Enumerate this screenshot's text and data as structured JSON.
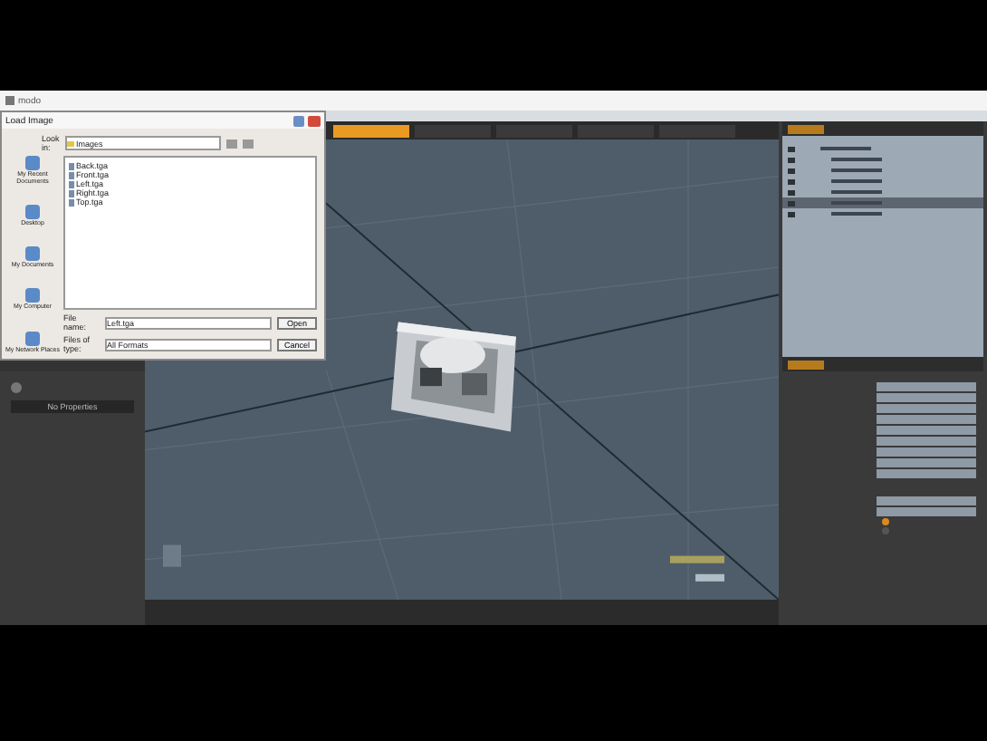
{
  "app": {
    "title": "modo"
  },
  "dialog": {
    "title": "Load Image",
    "look_in_label": "Look in:",
    "look_in": "Images",
    "places": [
      {
        "label": "My Recent Documents"
      },
      {
        "label": "Desktop"
      },
      {
        "label": "My Documents"
      },
      {
        "label": "My Computer"
      },
      {
        "label": "My Network Places"
      }
    ],
    "files": [
      "Back.tga",
      "Front.tga",
      "Left.tga",
      "Right.tga",
      "Top.tga"
    ],
    "file_name_label": "File name:",
    "file_name": "Left.tga",
    "file_type_label": "Files of type:",
    "file_type": "All Formats",
    "buttons": [
      "Open",
      "Cancel"
    ]
  },
  "left_panel": {
    "button": "No Properties"
  },
  "viewport_tabs": [
    {
      "selected": true
    },
    {
      "selected": false
    },
    {
      "selected": false
    },
    {
      "selected": false
    },
    {
      "selected": false
    }
  ],
  "tree_rows": [
    {
      "selected": false
    },
    {
      "selected": false
    },
    {
      "selected": false
    },
    {
      "selected": false
    },
    {
      "selected": false
    },
    {
      "selected": true
    },
    {
      "selected": false
    }
  ],
  "property_fields": [
    {
      "kind": "field"
    },
    {
      "kind": "field"
    },
    {
      "kind": "field"
    },
    {
      "kind": "field"
    },
    {
      "kind": "field"
    },
    {
      "kind": "field"
    },
    {
      "kind": "field"
    },
    {
      "kind": "field"
    },
    {
      "kind": "field"
    },
    {
      "kind": "gap"
    },
    {
      "kind": "field"
    },
    {
      "kind": "field"
    },
    {
      "kind": "check",
      "checked": true
    },
    {
      "kind": "check",
      "checked": false
    }
  ]
}
